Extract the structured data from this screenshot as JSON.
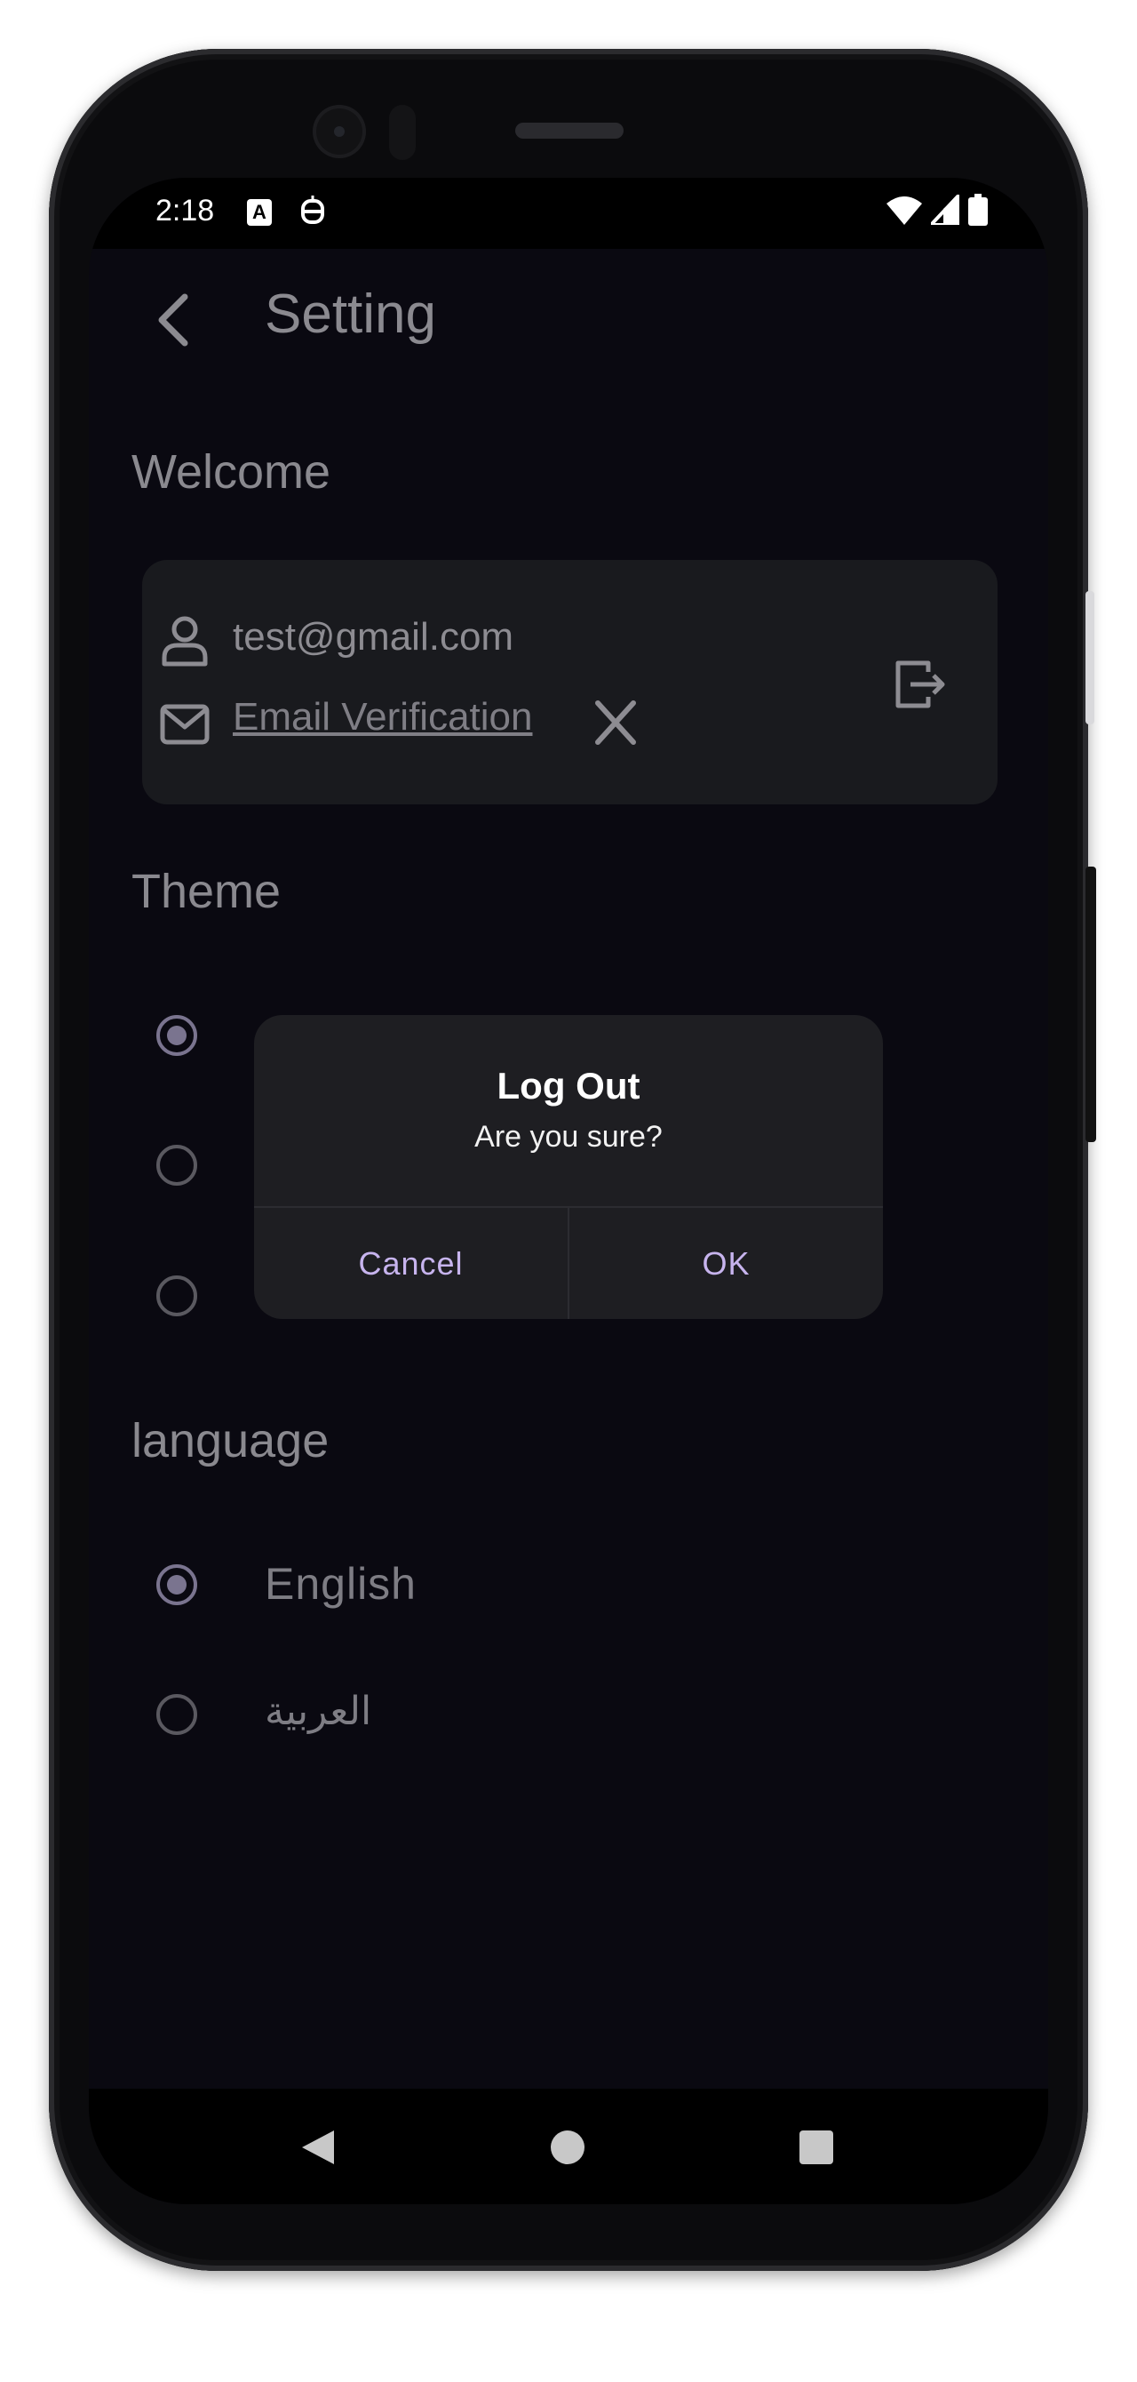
{
  "status_bar": {
    "time": "2:18",
    "icons": [
      "font-a-icon",
      "robot-icon",
      "wifi-icon",
      "signal-icon",
      "battery-icon"
    ]
  },
  "app_bar": {
    "title": "Setting",
    "back_icon": "chevron-left-icon"
  },
  "welcome": {
    "heading": "Welcome",
    "email": "test@gmail.com",
    "verification_label": "Email Verification",
    "icons": [
      "user-icon",
      "mail-icon",
      "close-icon",
      "logout-icon"
    ]
  },
  "theme": {
    "heading": "Theme",
    "options": [
      {
        "selected": true
      },
      {
        "selected": false
      },
      {
        "selected": false
      }
    ]
  },
  "language": {
    "heading": "language",
    "options": [
      {
        "label": "English",
        "selected": true
      },
      {
        "label": "العربية",
        "selected": false
      }
    ]
  },
  "dialog": {
    "title": "Log Out",
    "message": "Are you sure?",
    "cancel_label": "Cancel",
    "ok_label": "OK"
  },
  "nav_bar": {
    "icons": [
      "back-triangle-icon",
      "home-circle-icon",
      "recents-square-icon"
    ]
  },
  "colors": {
    "background": "#0a0911",
    "card": "#191a1e",
    "dialog": "#1e1e22",
    "accent": "#c7b4ee"
  }
}
